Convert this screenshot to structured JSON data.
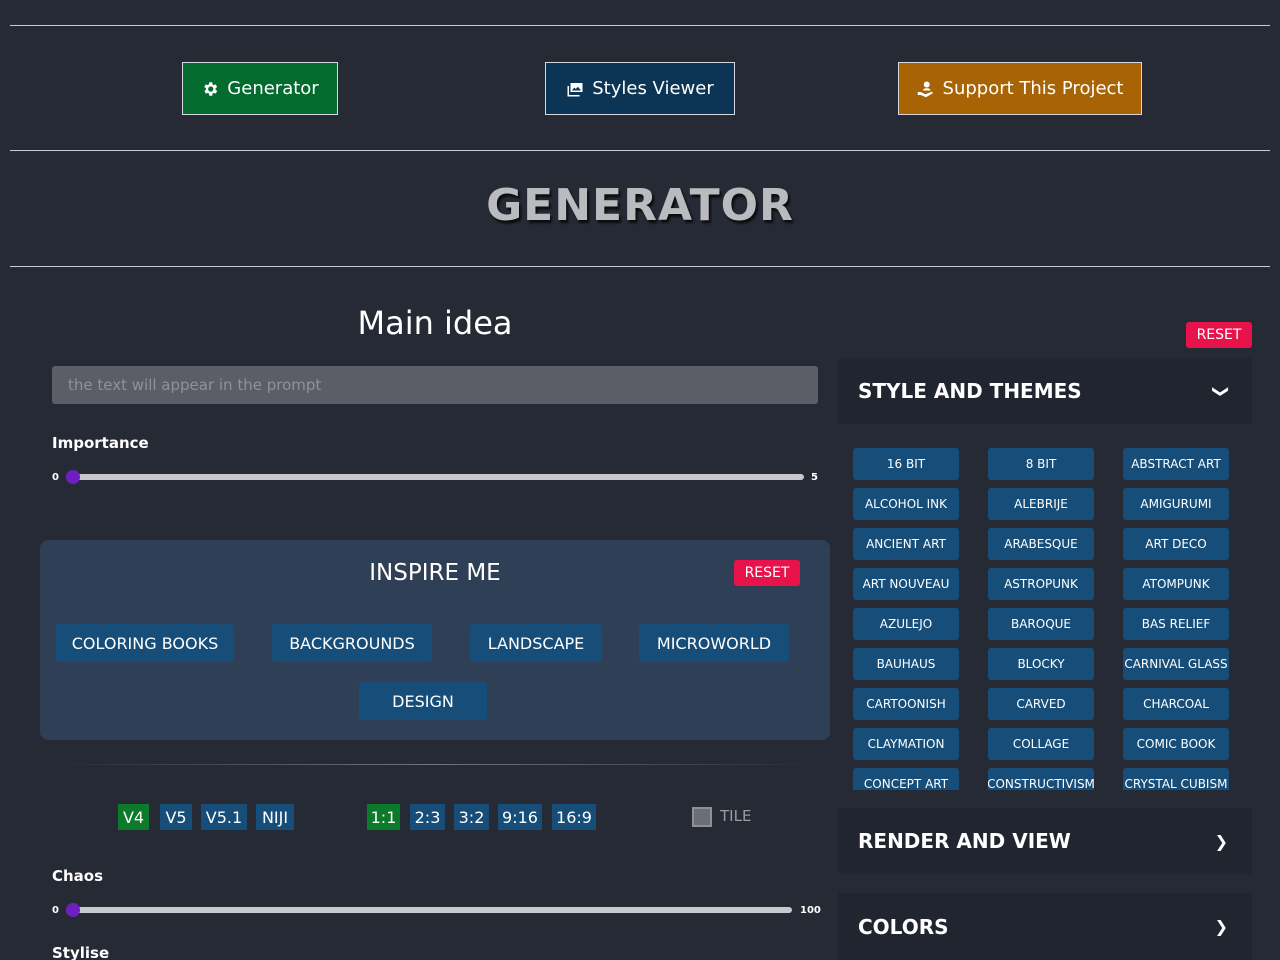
{
  "nav": {
    "generator": "Generator",
    "styles_viewer": "Styles Viewer",
    "support": "Support This Project"
  },
  "page_title": "GENERATOR",
  "main_idea": {
    "title": "Main idea",
    "placeholder": "the text will appear in the prompt",
    "reset": "RESET"
  },
  "importance": {
    "label": "Importance",
    "min": "0",
    "max": "5",
    "value": 0
  },
  "inspire": {
    "title": "INSPIRE ME",
    "reset": "RESET",
    "chips": [
      "COLORING BOOKS",
      "BACKGROUNDS",
      "LANDSCAPE",
      "MICROWORLD",
      "DESIGN"
    ]
  },
  "versions": [
    "V4",
    "V5",
    "V5.1",
    "NIJI"
  ],
  "active_version": "V4",
  "ratios": [
    "1:1",
    "2:3",
    "3:2",
    "9:16",
    "16:9"
  ],
  "active_ratio": "1:1",
  "tile": "TILE",
  "chaos": {
    "label": "Chaos",
    "min": "0",
    "max": "100",
    "value": 0
  },
  "stylise": {
    "label": "Stylise"
  },
  "sidebar": {
    "style_themes": "STYLE AND THEMES",
    "render_view": "RENDER AND VIEW",
    "colors": "COLORS",
    "styles": [
      "16 BIT",
      "8 BIT",
      "ABSTRACT ART",
      "ALCOHOL INK",
      "ALEBRIJE",
      "AMIGURUMI",
      "ANCIENT ART",
      "ARABESQUE",
      "ART DECO",
      "ART NOUVEAU",
      "ASTROPUNK",
      "ATOMPUNK",
      "AZULEJO",
      "BAROQUE",
      "BAS RELIEF",
      "BAUHAUS",
      "BLOCKY",
      "CARNIVAL GLASS",
      "CARTOONISH",
      "CARVED",
      "CHARCOAL",
      "CLAYMATION",
      "COLLAGE",
      "COMIC BOOK",
      "CONCEPT ART",
      "CONSTRUCTIVISM",
      "CRYSTAL CUBISM"
    ]
  },
  "colors": {
    "generator_btn": "#046b2e",
    "styles_btn": "#0c3454",
    "support_btn": "#a86404",
    "reset": "#e8134b",
    "chip": "#164e79",
    "active_chip": "#0b7a2a",
    "slider_thumb": "#6d1fc2"
  }
}
